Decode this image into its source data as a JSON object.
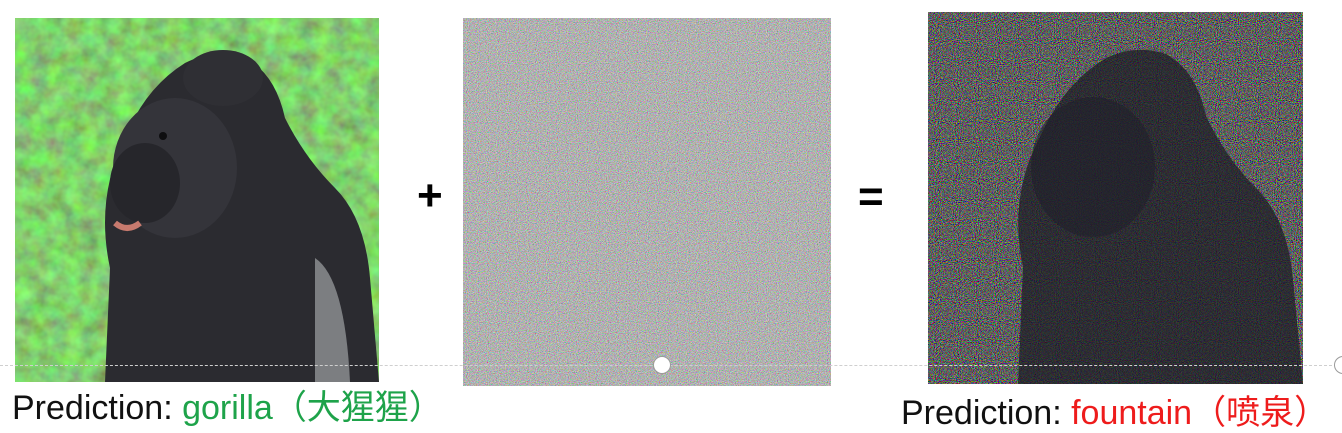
{
  "operators": {
    "plus": "+",
    "equals": "="
  },
  "left_image": {
    "label": "Prediction: ",
    "prediction": "gorilla",
    "prediction_cn": "（大猩猩）",
    "prediction_color": "#1ea34a"
  },
  "right_image": {
    "label": "Prediction: ",
    "prediction": "fountain",
    "prediction_cn": "（喷泉）",
    "prediction_color": "#ee1c1c"
  },
  "colors": {
    "noise_base": "#8a8890",
    "foliage": "#3f6a2a"
  }
}
